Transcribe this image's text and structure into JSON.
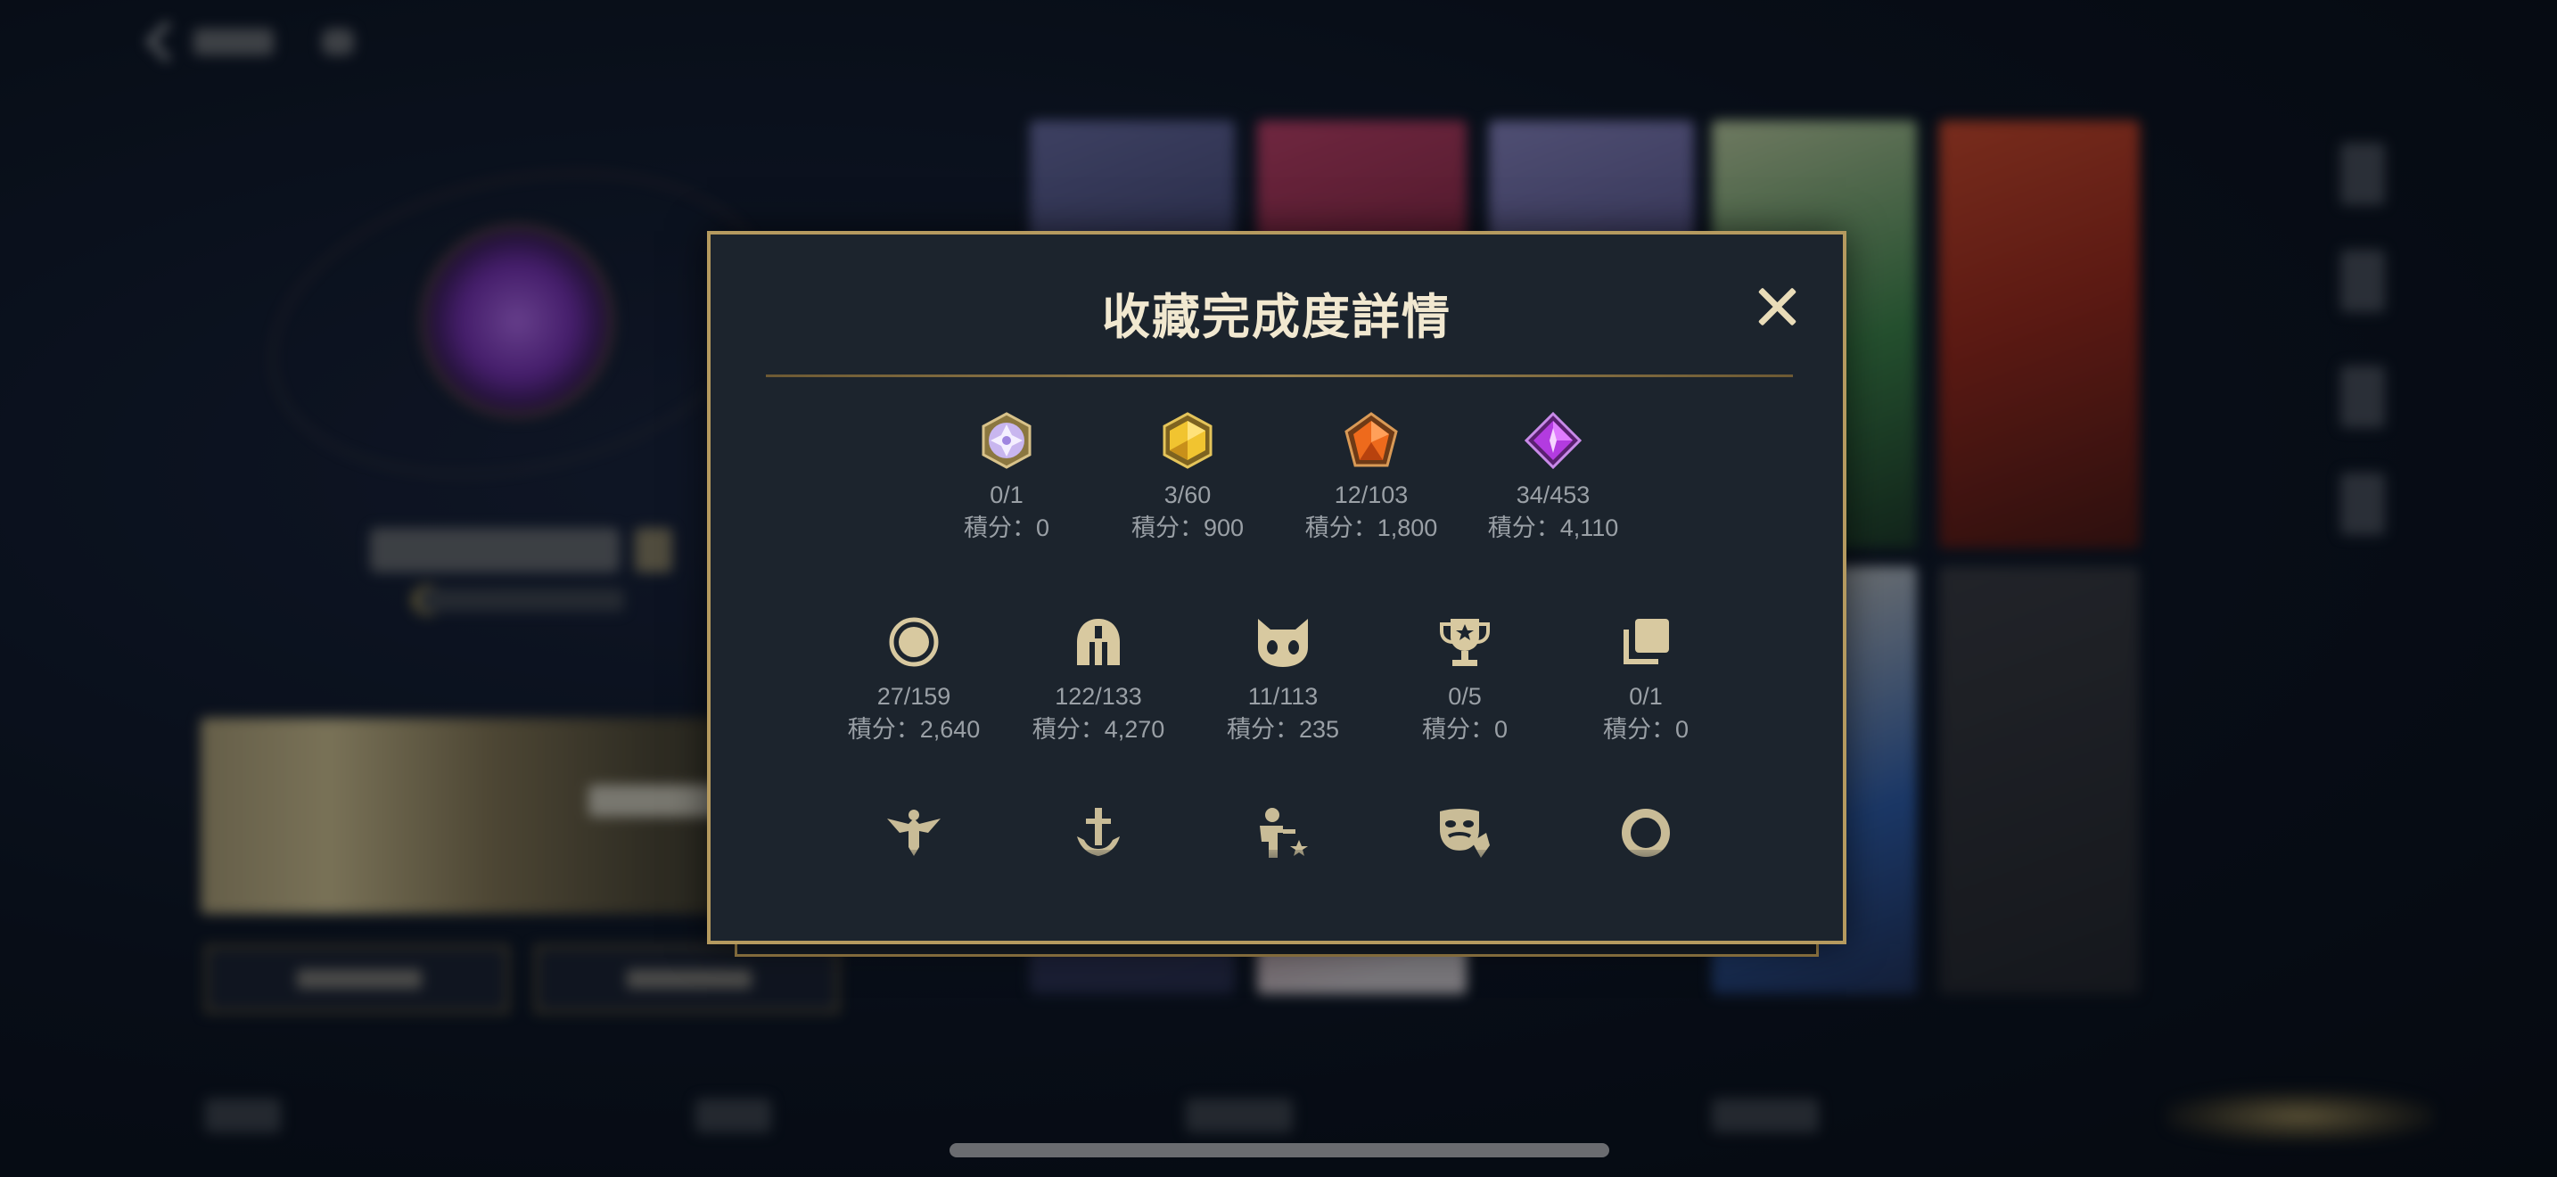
{
  "dialog": {
    "title": "收藏完成度詳情",
    "close_icon": "close-icon"
  },
  "rows": [
    [
      {
        "icon": "gem-white-icon",
        "count": "0/1",
        "points": "積分：0"
      },
      {
        "icon": "gem-gold-icon",
        "count": "3/60",
        "points": "積分：900"
      },
      {
        "icon": "gem-orange-icon",
        "count": "12/103",
        "points": "積分：1,800"
      },
      {
        "icon": "gem-purple-icon",
        "count": "34/453",
        "points": "積分：4,110"
      }
    ],
    [
      {
        "icon": "ring-icon",
        "count": "27/159",
        "points": "積分：2,640"
      },
      {
        "icon": "helmet-icon",
        "count": "122/133",
        "points": "積分：4,270"
      },
      {
        "icon": "cat-face-icon",
        "count": "11/113",
        "points": "積分：235"
      },
      {
        "icon": "trophy-icon",
        "count": "0/5",
        "points": "積分：0"
      },
      {
        "icon": "card-stack-icon",
        "count": "0/1",
        "points": "積分：0"
      }
    ],
    [
      {
        "icon": "winged-emblem-icon"
      },
      {
        "icon": "sword-emblem-icon"
      },
      {
        "icon": "player-star-icon"
      },
      {
        "icon": "mask-icon"
      },
      {
        "icon": "hollow-ring-icon"
      }
    ]
  ],
  "colors": {
    "gold_border": "#b59a5f",
    "panel_bg": "#1c242d",
    "title": "#f1e8d0",
    "stat_text": "#9aa0a6",
    "icon_gold": "#d8c9a0"
  }
}
